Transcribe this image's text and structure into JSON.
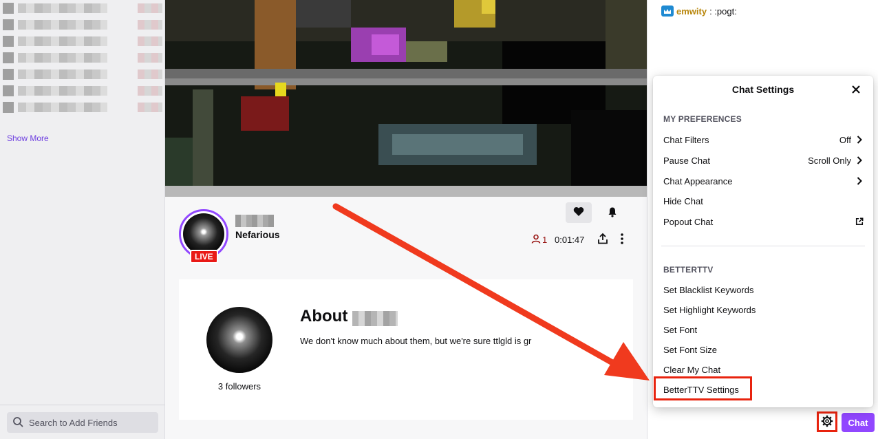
{
  "sidebar": {
    "show_more": "Show More",
    "search_placeholder": "Search to Add Friends"
  },
  "channel": {
    "category": "Nefarious",
    "live_badge": "LIVE",
    "viewers": "1",
    "uptime": "0:01:47"
  },
  "about": {
    "title": "About",
    "description": "We don't know much about them, but we're sure ttlgld is gr",
    "followers": "3 followers"
  },
  "chat": {
    "message_user": "emwity",
    "message_text": ": :pogt:",
    "chat_button": "Chat"
  },
  "chat_settings": {
    "title": "Chat Settings",
    "my_preferences": {
      "heading": "MY PREFERENCES",
      "items": [
        {
          "label": "Chat Filters",
          "value": "Off"
        },
        {
          "label": "Pause Chat",
          "value": "Scroll Only"
        },
        {
          "label": "Chat Appearance",
          "value": ""
        },
        {
          "label": "Hide Chat",
          "value": ""
        },
        {
          "label": "Popout Chat",
          "value": ""
        }
      ]
    },
    "betterttv": {
      "heading": "BETTERTTV",
      "items": [
        {
          "label": "Set Blacklist Keywords"
        },
        {
          "label": "Set Highlight Keywords"
        },
        {
          "label": "Set Font"
        },
        {
          "label": "Set Font Size"
        },
        {
          "label": "Clear My Chat"
        },
        {
          "label": "BetterTTV Settings"
        }
      ]
    }
  },
  "colors": {
    "accent": "#9147ff",
    "live": "#e91916",
    "annotation": "#e8230e"
  }
}
